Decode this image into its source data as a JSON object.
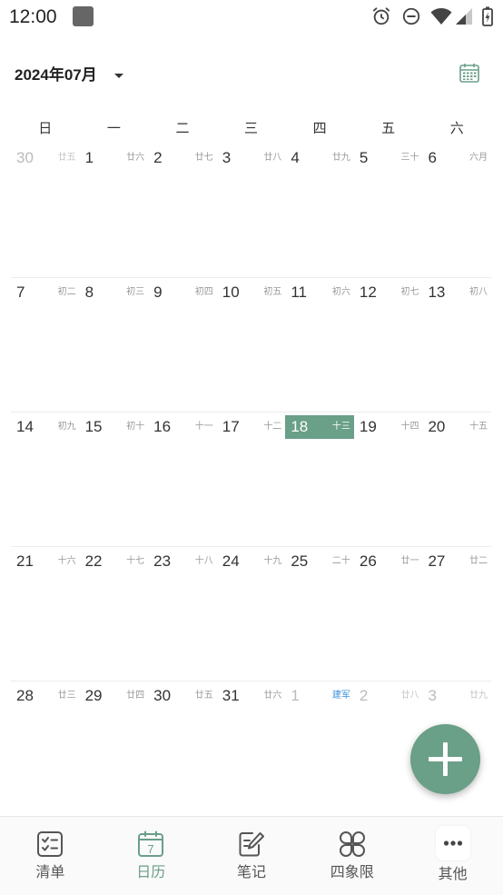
{
  "status_bar": {
    "time": "12:00",
    "icons": [
      "app-notification-icon",
      "alarm-icon",
      "do-not-disturb-icon",
      "wifi-icon",
      "signal-icon",
      "battery-charging-icon"
    ]
  },
  "header": {
    "month_label": "2024年07月",
    "dropdown_icon": "caret-down-icon",
    "view_toggle_icon": "calendar-view-icon"
  },
  "calendar": {
    "weekdays": [
      "日",
      "一",
      "二",
      "三",
      "四",
      "五",
      "六"
    ],
    "weeks": [
      [
        {
          "day": "30",
          "lunar": "廿五",
          "other_month": true
        },
        {
          "day": "1",
          "lunar": "廿六"
        },
        {
          "day": "2",
          "lunar": "廿七"
        },
        {
          "day": "3",
          "lunar": "廿八"
        },
        {
          "day": "4",
          "lunar": "廿九"
        },
        {
          "day": "5",
          "lunar": "三十"
        },
        {
          "day": "6",
          "lunar": "六月"
        }
      ],
      [
        {
          "day": "7",
          "lunar": "初二"
        },
        {
          "day": "8",
          "lunar": "初三"
        },
        {
          "day": "9",
          "lunar": "初四"
        },
        {
          "day": "10",
          "lunar": "初五"
        },
        {
          "day": "11",
          "lunar": "初六"
        },
        {
          "day": "12",
          "lunar": "初七"
        },
        {
          "day": "13",
          "lunar": "初八"
        }
      ],
      [
        {
          "day": "14",
          "lunar": "初九"
        },
        {
          "day": "15",
          "lunar": "初十"
        },
        {
          "day": "16",
          "lunar": "十一"
        },
        {
          "day": "17",
          "lunar": "十二"
        },
        {
          "day": "18",
          "lunar": "十三",
          "today": true
        },
        {
          "day": "19",
          "lunar": "十四"
        },
        {
          "day": "20",
          "lunar": "十五"
        }
      ],
      [
        {
          "day": "21",
          "lunar": "十六"
        },
        {
          "day": "22",
          "lunar": "十七"
        },
        {
          "day": "23",
          "lunar": "十八"
        },
        {
          "day": "24",
          "lunar": "十九"
        },
        {
          "day": "25",
          "lunar": "二十"
        },
        {
          "day": "26",
          "lunar": "廿一"
        },
        {
          "day": "27",
          "lunar": "廿二"
        }
      ],
      [
        {
          "day": "28",
          "lunar": "廿三"
        },
        {
          "day": "29",
          "lunar": "廿四"
        },
        {
          "day": "30",
          "lunar": "廿五"
        },
        {
          "day": "31",
          "lunar": "廿六"
        },
        {
          "day": "1",
          "lunar": "建军",
          "other_month": true,
          "holiday": true
        },
        {
          "day": "2",
          "lunar": "廿八",
          "other_month": true
        },
        {
          "day": "3",
          "lunar": "廿九",
          "other_month": true
        }
      ]
    ]
  },
  "fab": {
    "icon": "plus-icon"
  },
  "bottom_nav": {
    "selected": "日历",
    "items": [
      {
        "label": "清单",
        "icon": "checklist-icon"
      },
      {
        "label": "日历",
        "icon": "calendar-icon",
        "icon_text": "7"
      },
      {
        "label": "笔记",
        "icon": "note-edit-icon"
      },
      {
        "label": "四象限",
        "icon": "four-quadrant-icon"
      },
      {
        "label": "其他",
        "icon": "more-dots-icon"
      }
    ]
  },
  "colors": {
    "accent": "#6a9f88",
    "holiday": "#3b8fd9",
    "text": "#333333",
    "muted": "#999999",
    "other_month": "#bbbbbb"
  }
}
